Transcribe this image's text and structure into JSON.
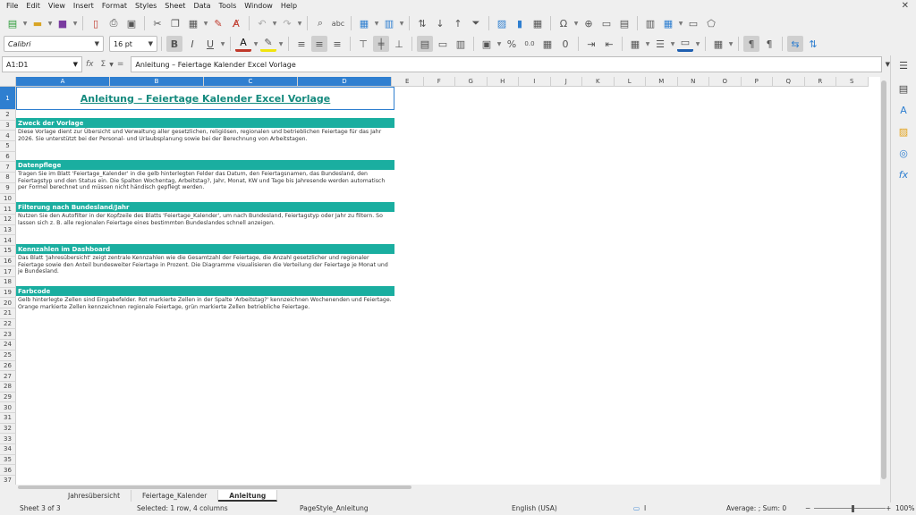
{
  "menubar": {
    "items": [
      "File",
      "Edit",
      "View",
      "Insert",
      "Format",
      "Styles",
      "Sheet",
      "Data",
      "Tools",
      "Window",
      "Help"
    ]
  },
  "toolbar": {
    "font_name": "Calibri",
    "font_size": "16 pt",
    "bold_label": "B",
    "italic_label": "I",
    "underline_label": "U",
    "font_color_glyph": "A",
    "percent_label": "%",
    "decimal_label": "0.0",
    "zero_label": "0"
  },
  "formula_bar": {
    "cell_ref": "A1:D1",
    "content": "Anleitung – Feiertage Kalender Excel Vorlage"
  },
  "grid": {
    "columns": [
      "A",
      "B",
      "C",
      "D",
      "E",
      "F",
      "G",
      "H",
      "I",
      "J",
      "K",
      "L",
      "M",
      "N",
      "O",
      "P",
      "Q",
      "R",
      "S"
    ],
    "rows": [
      "1",
      "2",
      "3",
      "4",
      "5",
      "6",
      "7",
      "8",
      "9",
      "10",
      "11",
      "12",
      "13",
      "14",
      "15",
      "16",
      "17",
      "18",
      "19",
      "20",
      "21",
      "22",
      "23",
      "24",
      "25",
      "26",
      "27",
      "28",
      "29",
      "30",
      "31",
      "32",
      "33",
      "34",
      "35",
      "36",
      "37"
    ]
  },
  "sheet": {
    "title": "Anleitung – Feiertage Kalender Excel Vorlage",
    "sections": [
      {
        "heading": "Zweck der Vorlage",
        "text": "Diese Vorlage dient zur Übersicht und Verwaltung aller gesetzlichen, religiösen, regionalen und betrieblichen Feiertage für das Jahr 2026. Sie unterstützt bei der Personal- und Urlaubsplanung sowie bei der Berechnung von Arbeitstagen."
      },
      {
        "heading": "Datenpflege",
        "text": "Tragen Sie im Blatt 'Feiertage_Kalender' in die gelb hinterlegten Felder das Datum, den Feiertagsnamen, das Bundesland, den Feiertagstyp und den Status ein. Die Spalten Wochentag, Arbeitstag?, Jahr, Monat, KW und Tage bis Jahresende werden automatisch per Formel berechnet und müssen nicht händisch gepflegt werden."
      },
      {
        "heading": "Filterung nach Bundesland/Jahr",
        "text": "Nutzen Sie den Autofilter in der Kopfzeile des Blatts 'Feiertage_Kalender', um nach Bundesland, Feiertagstyp oder Jahr zu filtern. So lassen sich z. B. alle regionalen Feiertage eines bestimmten Bundeslandes schnell anzeigen."
      },
      {
        "heading": "Kennzahlen im Dashboard",
        "text": "Das Blatt 'Jahresübersicht' zeigt zentrale Kennzahlen wie die Gesamtzahl der Feiertage, die Anzahl gesetzlicher und regionaler Feiertage sowie den Anteil bundesweiter Feiertage in Prozent. Die Diagramme visualisieren die Verteilung der Feiertage je Monat und je Bundesland."
      },
      {
        "heading": "Farbcode",
        "text": "Gelb hinterlegte Zellen sind Eingabefelder. Rot markierte Zellen in der Spalte 'Arbeitstag?' kennzeichnen Wochenenden und Feiertage. Orange markierte Zellen kennzeichnen regionale Feiertage, grün markierte Zellen betriebliche Feiertage."
      }
    ]
  },
  "tabs": [
    "Jahresübersicht",
    "Feiertage_Kalender",
    "Anleitung"
  ],
  "status": {
    "sheet": "Sheet 3 of 3",
    "selection": "Selected: 1 row, 4 columns",
    "page_style": "PageStyle_Anleitung",
    "language": "English (USA)",
    "summary": "Average: ; Sum: 0",
    "zoom": "100%"
  },
  "colors": {
    "accent": "#1aaea0",
    "title": "#158a7e",
    "selection": "#2f7fd0"
  }
}
